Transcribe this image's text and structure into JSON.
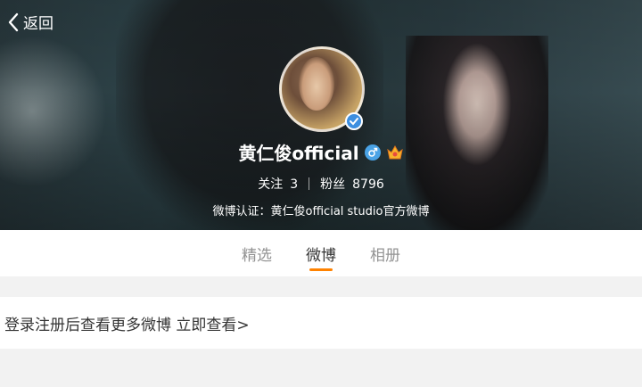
{
  "header": {
    "back_label": "返回"
  },
  "profile": {
    "name": "黄仁俊official",
    "following_label": "关注",
    "following_count": "3",
    "followers_label": "粉丝",
    "followers_count": "8796",
    "verification": "微博认证：黄仁俊official studio官方微博"
  },
  "tabs": [
    {
      "label": "精选",
      "active": false
    },
    {
      "label": "微博",
      "active": true
    },
    {
      "label": "相册",
      "active": false
    }
  ],
  "login_prompt": "登录注册后查看更多微博 立即查看>",
  "colors": {
    "accent": "#ff8200",
    "verified_badge": "#3d8fe0",
    "gender_badge": "#4aa3e6"
  },
  "icons": {
    "back": "chevron-left-icon",
    "verified": "verified-badge-icon",
    "gender": "male-icon",
    "vip": "vip-crown-icon"
  }
}
